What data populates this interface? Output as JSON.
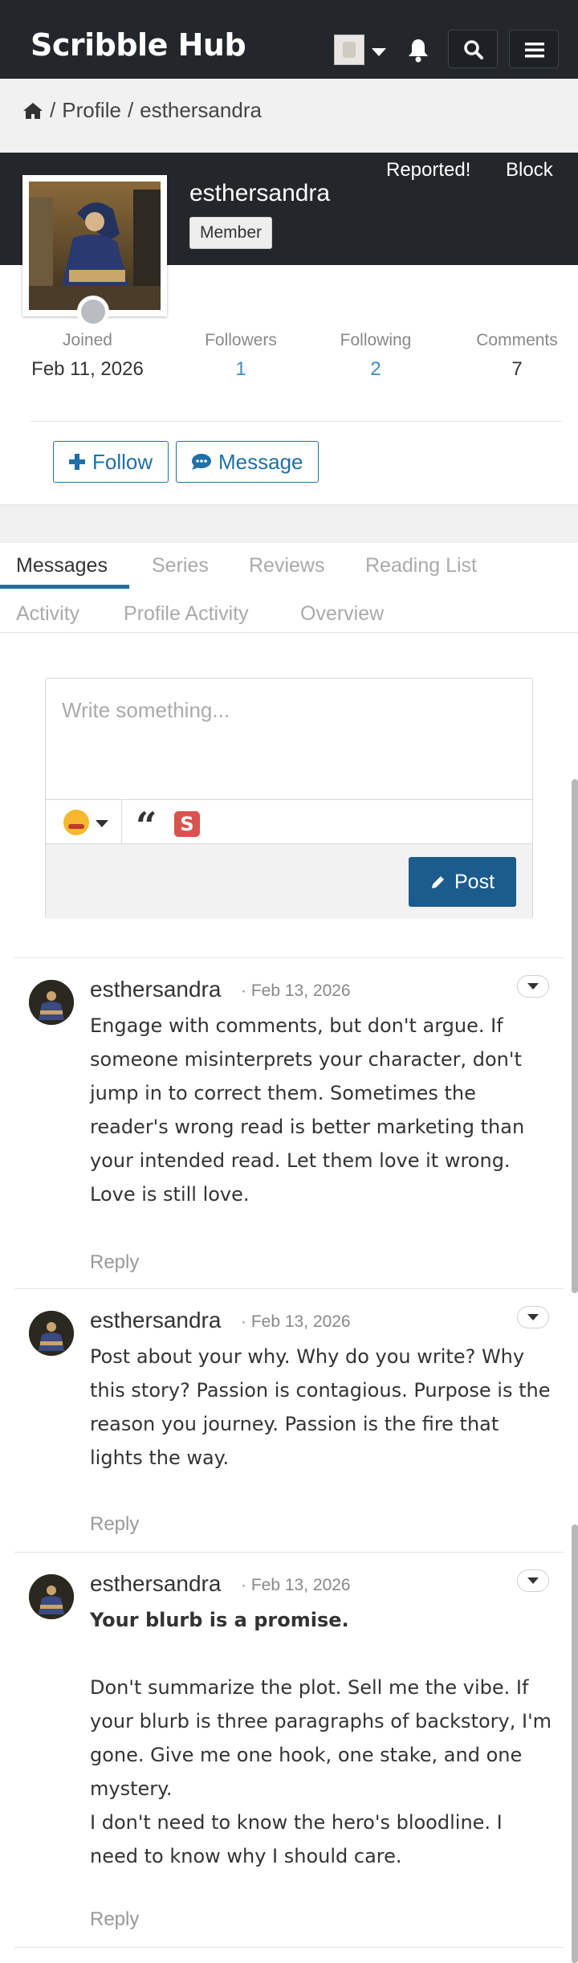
{
  "header": {
    "logo": "Scribble Hub",
    "icons": {
      "avatar": "user-avatar-icon",
      "notifications": "bell-icon",
      "search": "search-icon",
      "menu": "hamburger-icon"
    }
  },
  "breadcrumb": {
    "home_icon": "home-icon",
    "sep1": "/",
    "profile": "Profile",
    "sep2": "/",
    "user": "esthersandra"
  },
  "profile": {
    "username": "esthersandra",
    "badge": "Member",
    "reported": "Reported!",
    "block": "Block",
    "stats": [
      {
        "label": "Joined",
        "value": "Feb 11, 2026"
      },
      {
        "label": "Followers",
        "value": "1"
      },
      {
        "label": "Following",
        "value": "2"
      },
      {
        "label": "Comments",
        "value": "7"
      }
    ],
    "follow_label": "Follow",
    "message_label": "Message"
  },
  "tabs": [
    {
      "label": "Messages",
      "active": true
    },
    {
      "label": "Series"
    },
    {
      "label": "Reviews"
    },
    {
      "label": "Reading List"
    },
    {
      "label": "Activity"
    },
    {
      "label": "Profile Activity"
    },
    {
      "label": "Overview"
    }
  ],
  "composer": {
    "placeholder": "Write something...",
    "quote_glyph": "“",
    "spoiler_glyph": "S",
    "post_label": "Post"
  },
  "messages": [
    {
      "author": "esthersandra",
      "dot": "·",
      "date": "Feb 13, 2026",
      "body_lines": [
        "Engage with comments, but don't argue. If someone misinterprets your character, don't jump in to correct them. Sometimes the reader's wrong read is better marketing than your intended read. Let them love it wrong. Love is still love."
      ],
      "reply": "Reply"
    },
    {
      "author": "esthersandra",
      "dot": "·",
      "date": "Feb 13, 2026",
      "body_lines": [
        "Post about your why. Why do you write? Why this story? Passion is contagious. Purpose is the reason you journey. Passion is the fire that lights the way."
      ],
      "reply": "Reply"
    },
    {
      "author": "esthersandra",
      "dot": "·",
      "date": "Feb 13, 2026",
      "body_heading": "Your blurb is a promise.",
      "body_lines": [
        "Don't summarize the plot. Sell me the vibe. If your blurb is three paragraphs of backstory, I'm gone. Give me one hook, one stake, and one mystery.",
        "I don't need to know the hero's bloodline. I need to know why I should care."
      ],
      "reply": "Reply"
    }
  ],
  "colors": {
    "header_bg": "#23272b",
    "accent": "#1f6fa8",
    "post_btn": "#1c5c8c",
    "link_blue": "#3b8fc4",
    "spoiler": "#d9534f"
  }
}
